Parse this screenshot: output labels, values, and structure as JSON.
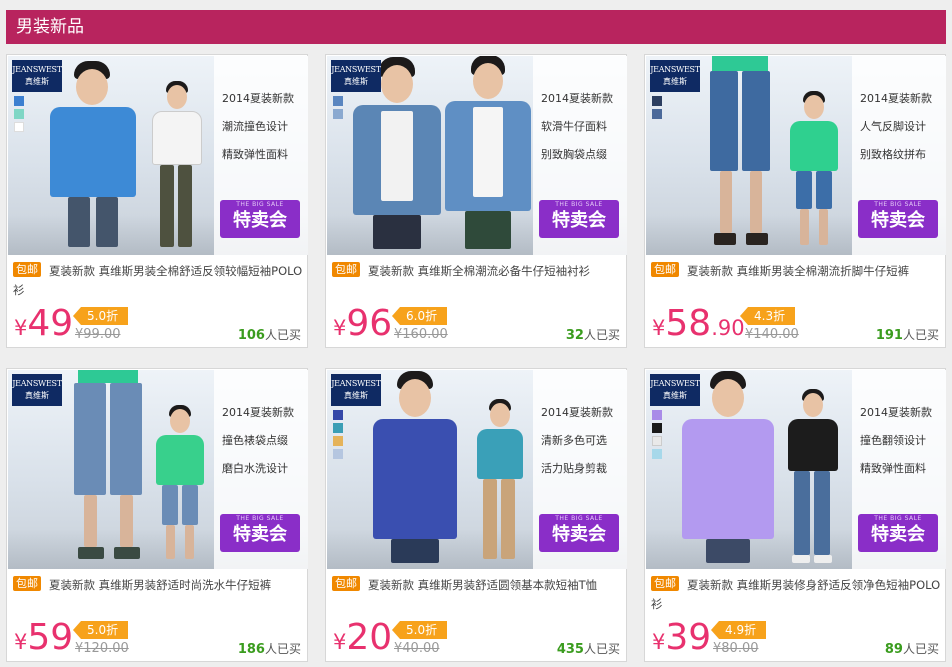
{
  "section": {
    "title": "男装新品"
  },
  "colors": {
    "header_bg": "#b8245e",
    "price": "#e8316e",
    "discount_bg": "#f7a21b",
    "sale_badge": "#8a2ec8",
    "sold_count": "#3a9c1e",
    "free_ship_tag": "#f08800"
  },
  "brand": {
    "logo_en": "JEANSWEST",
    "logo_cn": "真维斯"
  },
  "products": [
    {
      "features": [
        "2014夏装新款",
        "潮流撞色设计",
        "精致弹性面料"
      ],
      "sale_badge": {
        "sub": "THE BIG SALE",
        "main": "特卖会"
      },
      "tag": "包邮",
      "title": "夏装新款 真维斯男装全棉舒适反领较幅短袖POLO衫",
      "price_symbol": "¥",
      "price_int": "49",
      "price_dec": "",
      "discount": "5.0折",
      "original_price": "¥99.00",
      "sold_count": "106",
      "sold_suffix": "人已买",
      "swatches": [
        "#3c7fd0",
        "#7fd6c5",
        "#ffffff"
      ],
      "icons": [
        "jeanswest-logo-icon",
        "model-photo-icon"
      ]
    },
    {
      "features": [
        "2014夏装新款",
        "软滑牛仔面料",
        "别致胸袋点缀"
      ],
      "sale_badge": {
        "sub": "THE BIG SALE",
        "main": "特卖会"
      },
      "tag": "包邮",
      "title": "夏装新款 真维斯全棉潮流必备牛仔短袖衬衫",
      "price_symbol": "¥",
      "price_int": "96",
      "price_dec": "",
      "discount": "6.0折",
      "original_price": "¥160.00",
      "sold_count": "32",
      "sold_suffix": "人已买",
      "swatches": [
        "#5a86c0",
        "#8aa9d0"
      ],
      "icons": [
        "jeanswest-logo-icon",
        "model-photo-icon"
      ]
    },
    {
      "features": [
        "2014夏装新款",
        "人气反脚设计",
        "别致格纹拼布"
      ],
      "sale_badge": {
        "sub": "THE BIG SALE",
        "main": "特卖会"
      },
      "tag": "包邮",
      "title": "夏装新款 真维斯男装全棉潮流折脚牛仔短裤",
      "price_symbol": "¥",
      "price_int": "58",
      "price_dec": ".90",
      "discount": "4.3折",
      "original_price": "¥140.00",
      "sold_count": "191",
      "sold_suffix": "人已买",
      "swatches": [
        "#2c3e60",
        "#4c6a9a"
      ],
      "icons": [
        "jeanswest-logo-icon",
        "model-photo-icon"
      ]
    },
    {
      "features": [
        "2014夏装新款",
        "撞色裱袋点缀",
        "磨白水洗设计"
      ],
      "sale_badge": {
        "sub": "THE BIG SALE",
        "main": "特卖会"
      },
      "tag": "包邮",
      "title": "夏装新款 真维斯男装舒适时尚洗水牛仔短裤",
      "price_symbol": "¥",
      "price_int": "59",
      "price_dec": "",
      "discount": "5.0折",
      "original_price": "¥120.00",
      "sold_count": "186",
      "sold_suffix": "人已买",
      "swatches": [],
      "icons": [
        "jeanswest-logo-icon",
        "model-photo-icon"
      ]
    },
    {
      "features": [
        "2014夏装新款",
        "清新多色可选",
        "活力贴身剪裁"
      ],
      "sale_badge": {
        "sub": "THE BIG SALE",
        "main": "特卖会"
      },
      "tag": "包邮",
      "title": "夏装新款 真维斯男装舒适圆领基本款短袖T恤",
      "price_symbol": "¥",
      "price_int": "20",
      "price_dec": "",
      "discount": "5.0折",
      "original_price": "¥40.00",
      "sold_count": "435",
      "sold_suffix": "人已买",
      "swatches": [
        "#3548a8",
        "#3b9eb5",
        "#e5b35a",
        "#b5c6e0"
      ],
      "icons": [
        "jeanswest-logo-icon",
        "model-photo-icon"
      ]
    },
    {
      "features": [
        "2014夏装新款",
        "撞色翻领设计",
        "精致弹性面料"
      ],
      "sale_badge": {
        "sub": "THE BIG SALE",
        "main": "特卖会"
      },
      "tag": "包邮",
      "title": "夏装新款 真维斯男装修身舒适反领净色短袖POLO衫",
      "price_symbol": "¥",
      "price_int": "39",
      "price_dec": "",
      "discount": "4.9折",
      "original_price": "¥80.00",
      "sold_count": "89",
      "sold_suffix": "人已买",
      "swatches": [
        "#a98be8",
        "#1a1a1a",
        "#e9e9e9",
        "#a7d8ea"
      ],
      "icons": [
        "jeanswest-logo-icon",
        "model-photo-icon"
      ]
    }
  ]
}
